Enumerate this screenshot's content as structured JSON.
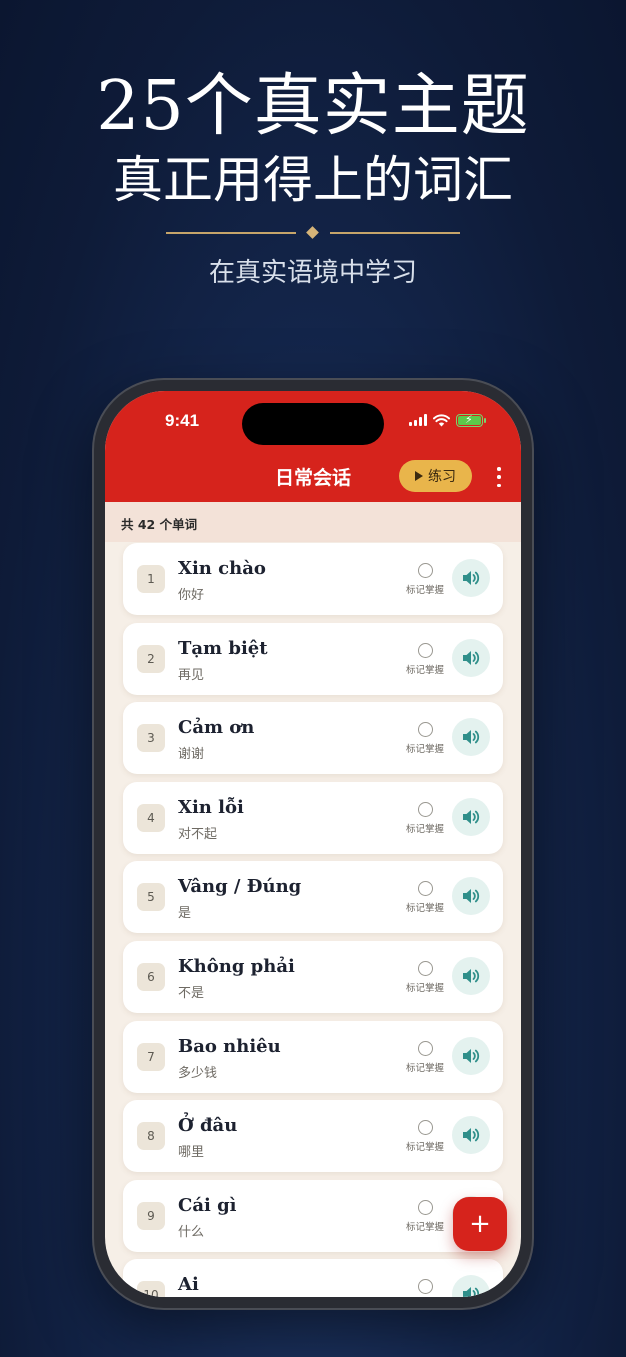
{
  "hero": {
    "title": "25个真实主题",
    "subtitle": "真正用得上的词汇",
    "tagline": "在真实语境中学习"
  },
  "status_bar": {
    "time": "9:41"
  },
  "nav": {
    "title": "日常会话",
    "practice_label": "练习"
  },
  "count_label": "共 42 个单词",
  "mark_label": "标记掌握",
  "words": [
    {
      "num": "1",
      "word": "Xin chào",
      "meaning": "你好"
    },
    {
      "num": "2",
      "word": "Tạm biệt",
      "meaning": "再见"
    },
    {
      "num": "3",
      "word": "Cảm ơn",
      "meaning": "谢谢"
    },
    {
      "num": "4",
      "word": "Xin lỗi",
      "meaning": "对不起"
    },
    {
      "num": "5",
      "word": "Vâng / Đúng",
      "meaning": "是"
    },
    {
      "num": "6",
      "word": "Không phải",
      "meaning": "不是"
    },
    {
      "num": "7",
      "word": "Bao nhiêu",
      "meaning": "多少钱"
    },
    {
      "num": "8",
      "word": "Ở đâu",
      "meaning": "哪里"
    },
    {
      "num": "9",
      "word": "Cái gì",
      "meaning": "什么"
    },
    {
      "num": "10",
      "word": "Ai",
      "meaning": ""
    }
  ],
  "fab_label": "+",
  "colors": {
    "brand_red": "#d6231c",
    "accent_gold": "#e9b54b",
    "audio_teal": "#2f8f8a"
  }
}
